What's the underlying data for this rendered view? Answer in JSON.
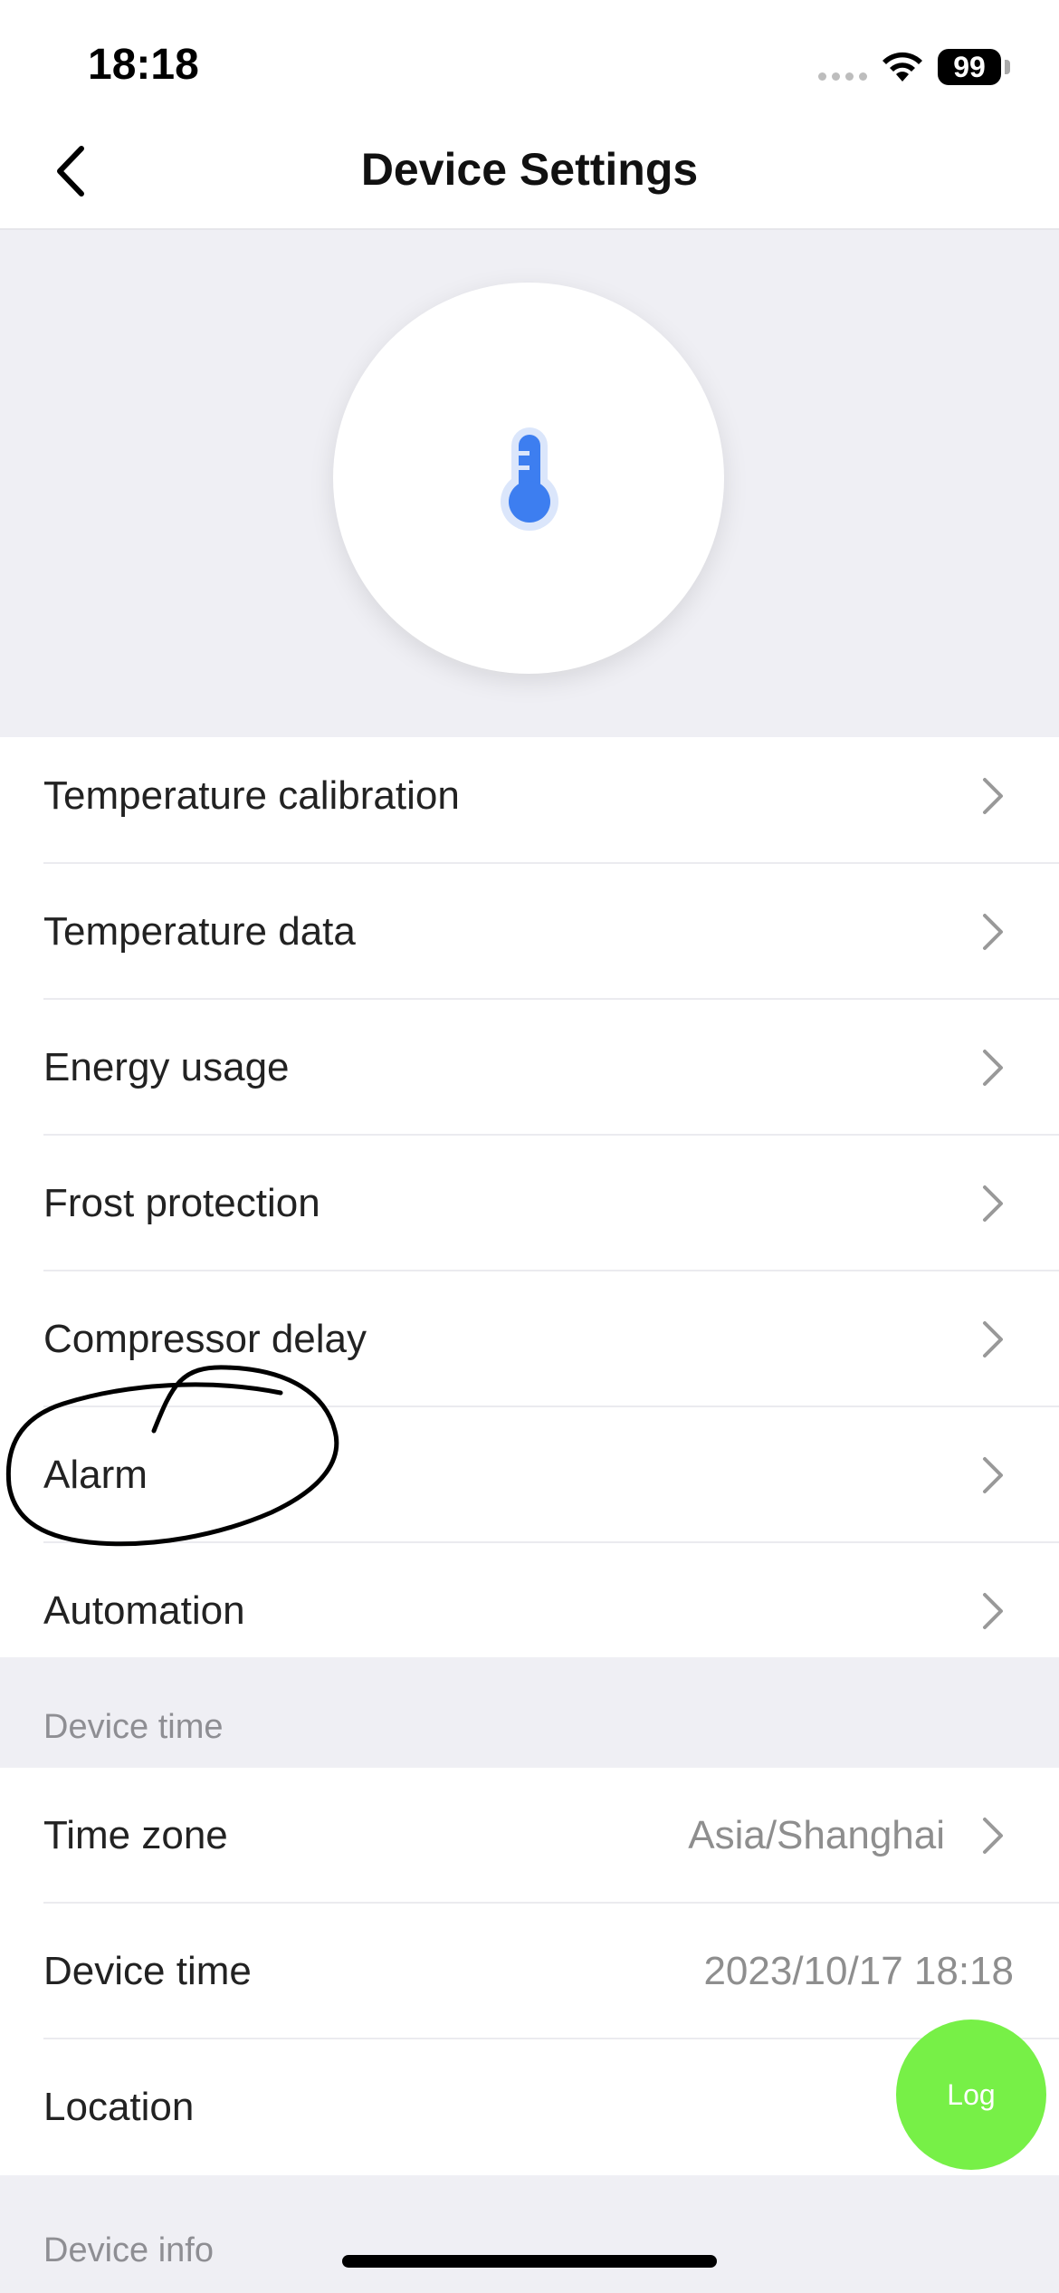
{
  "status_bar": {
    "time": "18:18",
    "battery": "99"
  },
  "nav": {
    "title": "Device Settings"
  },
  "settings": [
    {
      "label": "Temperature calibration"
    },
    {
      "label": "Temperature data"
    },
    {
      "label": "Energy usage"
    },
    {
      "label": "Frost protection"
    },
    {
      "label": "Compressor delay"
    },
    {
      "label": "Alarm"
    },
    {
      "label": "Automation"
    }
  ],
  "device_time_section": {
    "header": "Device time",
    "rows": [
      {
        "label": "Time zone",
        "value": "Asia/Shanghai"
      },
      {
        "label": "Device time",
        "value": "2023/10/17 18:18"
      },
      {
        "label": "Location"
      }
    ]
  },
  "device_info_section": {
    "header": "Device info"
  },
  "log_button": {
    "label": "Log"
  },
  "colors": {
    "accent": "#3d7ef0",
    "log": "#77f047",
    "background": "#efeff4"
  },
  "icons": [
    "back-chevron-icon",
    "thermometer-icon",
    "chevron-right-icon",
    "wifi-icon",
    "battery-icon"
  ]
}
